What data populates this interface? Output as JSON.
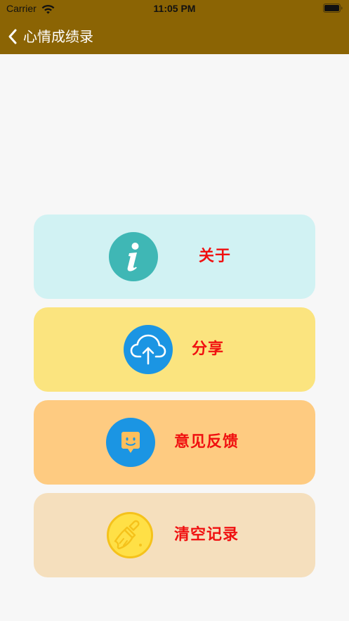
{
  "status_bar": {
    "carrier": "Carrier",
    "time": "11:05 PM",
    "wifi_icon": "wifi-icon",
    "battery_icon": "battery-icon"
  },
  "nav": {
    "title": "心情成绩录",
    "back_icon": "chevron-left-icon"
  },
  "menu": {
    "items": [
      {
        "label": "关于",
        "icon": "info-icon",
        "background": "#d1f2f3",
        "icon_color": "#3fb7b5"
      },
      {
        "label": "分享",
        "icon": "cloud-upload-icon",
        "background": "#fbe47f",
        "icon_color": "#1b95e3"
      },
      {
        "label": "意见反馈",
        "icon": "chat-smile-icon",
        "background": "#fecb81",
        "icon_color": "#1b95e3"
      },
      {
        "label": "清空记录",
        "icon": "broom-icon",
        "background": "#f5dfbd",
        "icon_color": "#ffe046"
      }
    ]
  },
  "colors": {
    "header": "#8b6404",
    "label_text": "#f01010",
    "page_background": "#f7f7f7"
  }
}
